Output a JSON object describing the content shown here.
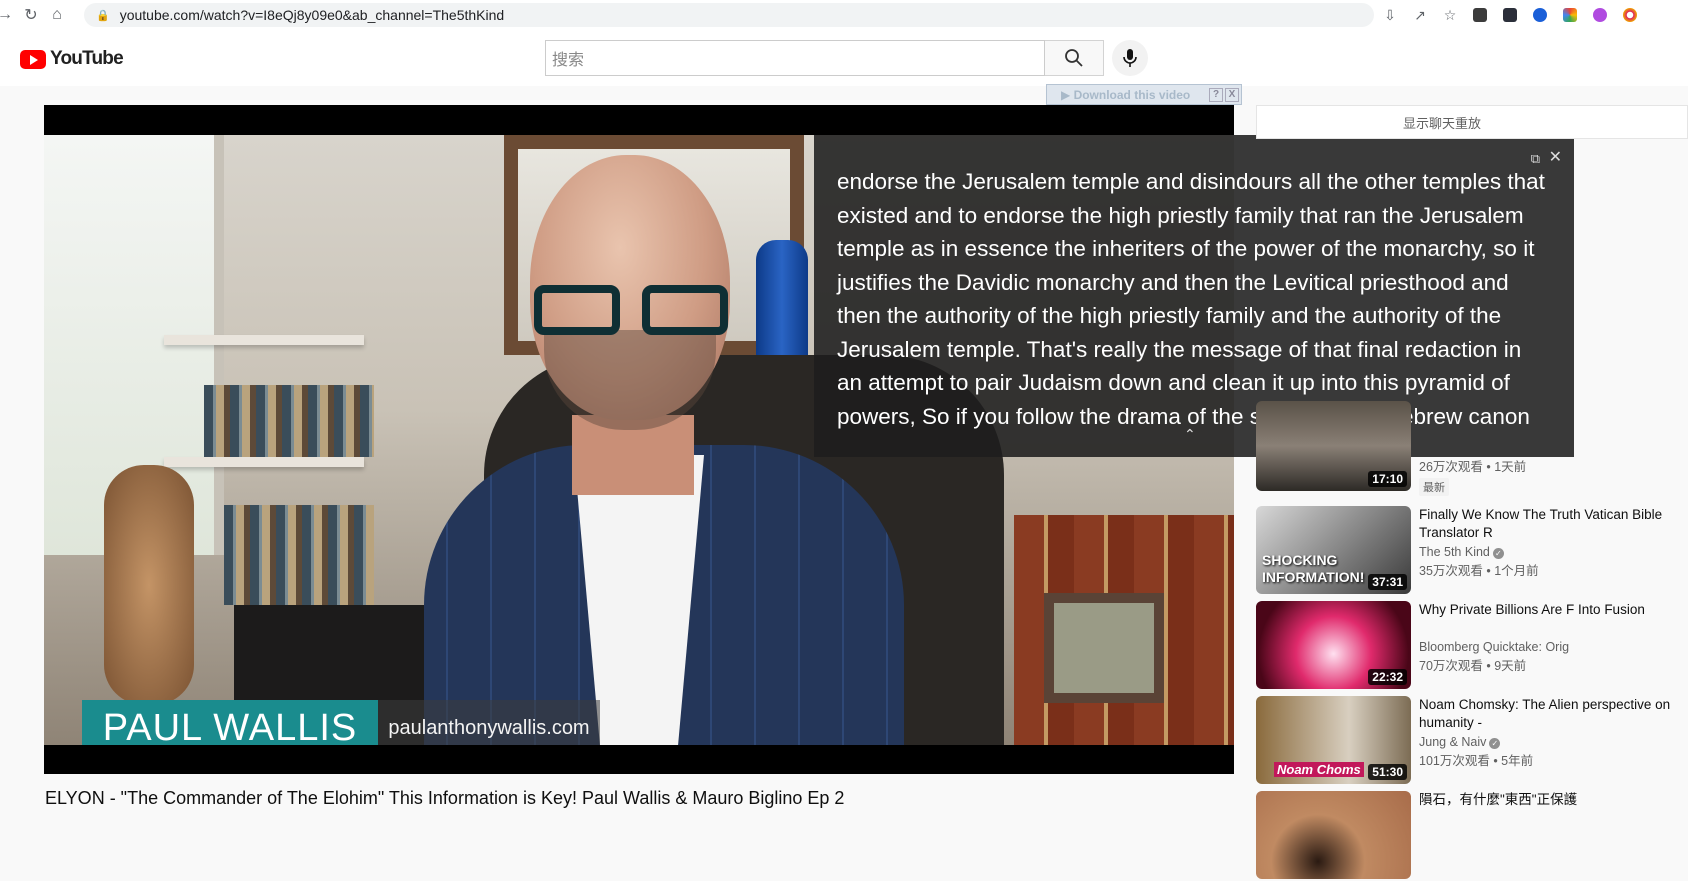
{
  "browser": {
    "url": "youtube.com/watch?v=I8eQj8y09e0&ab_channel=The5thKind"
  },
  "header": {
    "logo_text": "YouTube",
    "search_placeholder": "搜索"
  },
  "download_bar": {
    "label": "▶ Download this video",
    "help": "?",
    "close": "X"
  },
  "player": {
    "lower_third_name": "PAUL WALLIS",
    "lower_third_site": "paulanthonywallis.com",
    "captions": "endorse the Jerusalem temple and disindours all the other temples that existed and to endorse the high priestly family that ran the Jerusalem temple as in essence the inheriters of the power of the monarchy, so it justifies the Davidic monarchy and then the Levitical priesthood and then the authority of the high priestly family and the authority of the Jerusalem temple. That's really the message of that final redaction in an attempt to pair Judaism down and clean it up into this pyramid of powers, So if you follow the drama of the stories of the Hebrew canon"
  },
  "video": {
    "title": "ELYON - \"The Commander of The Elohim\" This Information is Key! Paul Wallis & Mauro Biglino Ep 2"
  },
  "sidebar": {
    "chat_replay": "显示聊天重放",
    "recommendations": [
      {
        "title": "",
        "channel": "",
        "meta": "26万次观看 • 1天前",
        "badge": "最新",
        "duration": "17:10",
        "thumb_color": "#3a3530"
      },
      {
        "title": "Finally We Know The Truth Vatican Bible Translator R",
        "channel": "The 5th Kind",
        "meta": "35万次观看 • 1个月前",
        "badge": "",
        "duration": "37:31",
        "thumb_color": "#2b2b2b",
        "thumb_text": "SHOCKING INFORMATION!"
      },
      {
        "title": "Why Private Billions Are F Into Fusion",
        "channel": "Bloomberg Quicktake: Orig",
        "meta": "70万次观看 • 9天前",
        "badge": "",
        "duration": "22:32",
        "thumb_color": "#b0143a"
      },
      {
        "title": "Noam Chomsky: The Alien perspective on humanity -",
        "channel": "Jung & Naiv",
        "meta": "101万次观看 • 5年前",
        "badge": "",
        "duration": "51:30",
        "thumb_color": "#7c6c54",
        "thumb_text": "Noam Choms"
      },
      {
        "title": "隕石，有什麼\"東西\"正保護",
        "channel": "",
        "meta": "",
        "badge": "",
        "duration": "",
        "thumb_color": "#b07a5a"
      }
    ]
  }
}
